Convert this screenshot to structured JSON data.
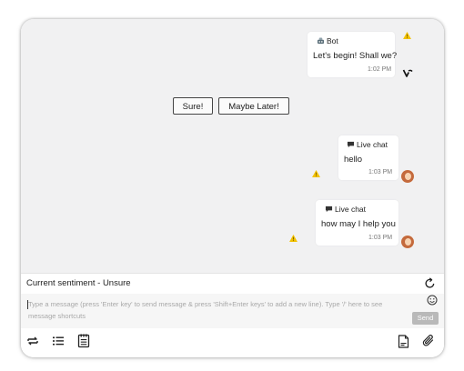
{
  "messages": [
    {
      "sender_label": "Bot",
      "sender_icon": "bot-icon",
      "text": "Let's begin! Shall we?",
      "time": "1:02 PM",
      "avatar": "bot-logo-icon",
      "flag": "warning-icon"
    },
    {
      "sender_label": "Live chat",
      "sender_icon": "chat-bubble-icon",
      "text": "hello",
      "time": "1:03 PM",
      "avatar": "agent-avatar",
      "flag": "warning-icon"
    },
    {
      "sender_label": "Live chat",
      "sender_icon": "chat-bubble-icon",
      "text": "how may I help you",
      "time": "1:03 PM",
      "avatar": "agent-avatar",
      "flag": "warning-icon"
    }
  ],
  "quick_replies": [
    "Sure!",
    "Maybe Later!"
  ],
  "sentiment": {
    "label": "Current sentiment - Unsure",
    "refresh_icon": "refresh-icon"
  },
  "composer": {
    "placeholder": "Type a message (press 'Enter key' to send message & press 'Shift+Enter keys' to add a new line). Type '/' here to see message shortcuts",
    "emoji_icon": "emoji-icon",
    "send_label": "Send"
  },
  "toolbar": {
    "left_icons": [
      "transfer-icon",
      "list-icon",
      "notes-icon"
    ],
    "right_icons": [
      "document-icon",
      "attachment-icon"
    ]
  },
  "colors": {
    "chat_bg": "#f1f1f2",
    "warning": "#f2c200",
    "send_disabled": "#b9b9b9"
  }
}
